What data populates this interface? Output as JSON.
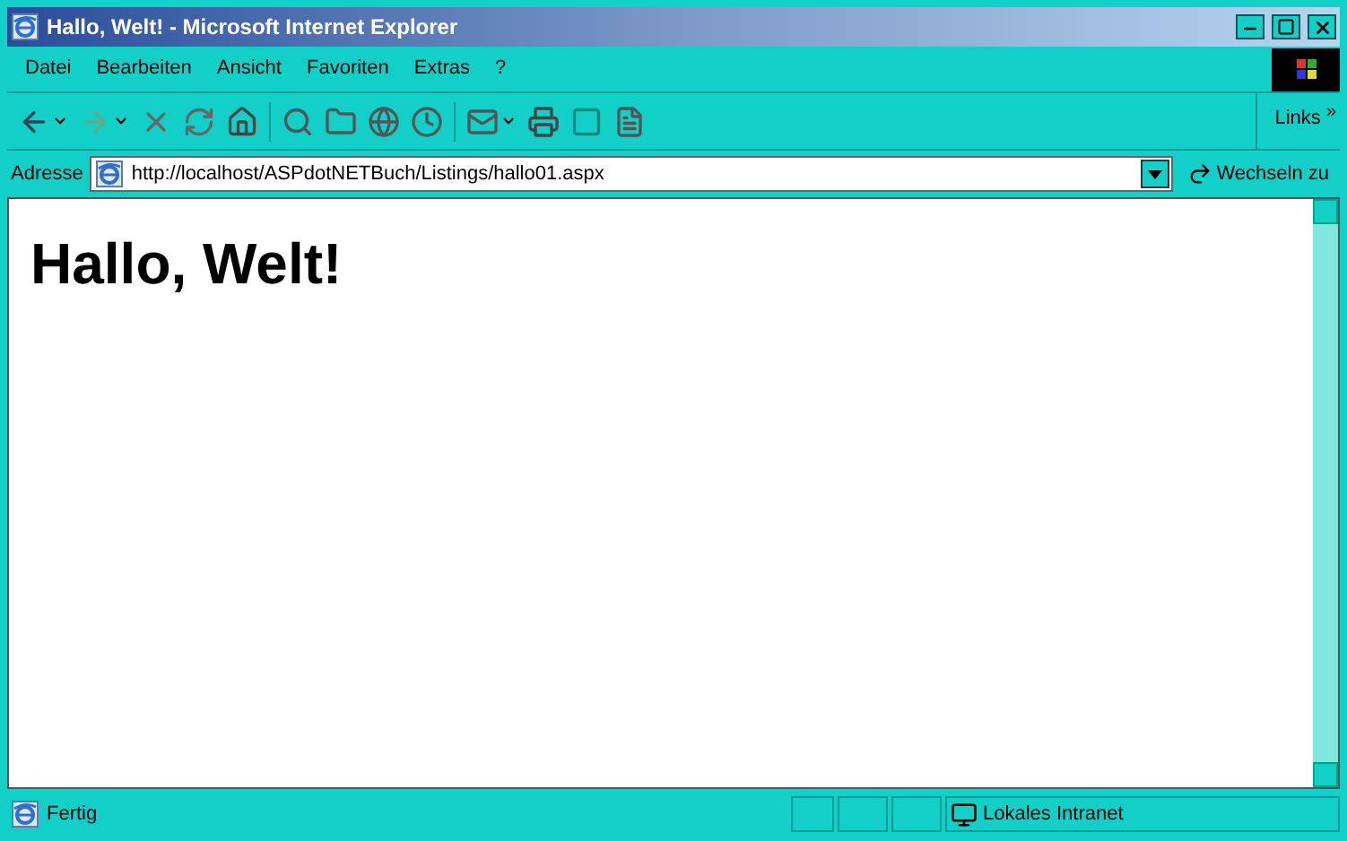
{
  "window": {
    "title": "Hallo, Welt! - Microsoft Internet Explorer"
  },
  "menu": {
    "items": [
      "Datei",
      "Bearbeiten",
      "Ansicht",
      "Favoriten",
      "Extras",
      "?"
    ]
  },
  "links": {
    "label": "Links",
    "chevron": "»"
  },
  "address": {
    "label": "Adresse",
    "value": "http://localhost/ASPdotNETBuch/Listings/hallo01.aspx",
    "go_button": "Wechseln zu"
  },
  "page": {
    "heading": "Hallo, Welt!"
  },
  "status_bar": {
    "text": "Fertig",
    "zone": "Lokales Intranet"
  }
}
